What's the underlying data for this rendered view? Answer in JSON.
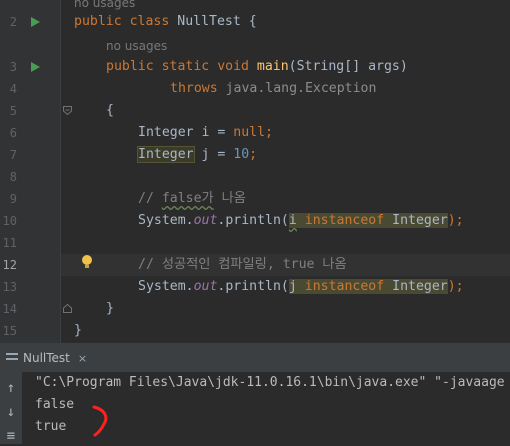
{
  "editor": {
    "line_numbers": [
      "2",
      "3",
      "4",
      "5",
      "6",
      "7",
      "8",
      "9",
      "10",
      "11",
      "12",
      "13",
      "14",
      "15"
    ],
    "current_line": "12",
    "hints": {
      "top_usages": "no usages",
      "main_usages": "no usages"
    },
    "lines": {
      "l2": {
        "kw1": "public",
        "kw2": "class",
        "name": "NullTest",
        "rest": " {"
      },
      "l3": {
        "kw1": "public",
        "kw2": "static",
        "kw3": "void",
        "method": "main",
        "params": "(String[] args)"
      },
      "l4": {
        "kw": "throws",
        "rest": " java.lang.Exception"
      },
      "l5": {
        "text": "{"
      },
      "l6": {
        "type": "Integer",
        "mid": " i = ",
        "kw": "null",
        "end": ";"
      },
      "l7": {
        "type": "Integer",
        "mid": " j = ",
        "num": "10",
        "end": ";"
      },
      "l9": {
        "pre": "// ",
        "wavy": "false가",
        "post": " 나옴"
      },
      "l10": {
        "pre": "System.",
        "field": "out",
        "mid": ".println(",
        "var": "i",
        "space": " ",
        "kw": "instanceof",
        "cls": " Integer",
        "end": ");"
      },
      "l12": {
        "text": "// 성공적인 컴파일링, true 나옴"
      },
      "l13": {
        "pre": "System.",
        "field": "out",
        "mid": ".println(",
        "var": "j",
        "space": " ",
        "kw": "instanceof",
        "cls": " Integer",
        "end": ");"
      },
      "l14": {
        "text": "}"
      },
      "l15": {
        "text": "}"
      }
    }
  },
  "run_panel": {
    "tab_label": "NullTest",
    "close_glyph": "×",
    "tools": [
      "↑",
      "↓",
      "≡"
    ],
    "console": [
      "\"C:\\Program Files\\Java\\jdk-11.0.16.1\\bin\\java.exe\" \"-javaage",
      "false",
      "true"
    ],
    "annotation_color": "#ff2020"
  },
  "colors": {
    "keyword": "#cc7832",
    "method": "#ffc66d",
    "number": "#6897bb",
    "comment": "#808080",
    "static_field": "#9876aa",
    "run_icon": "#499c54"
  }
}
